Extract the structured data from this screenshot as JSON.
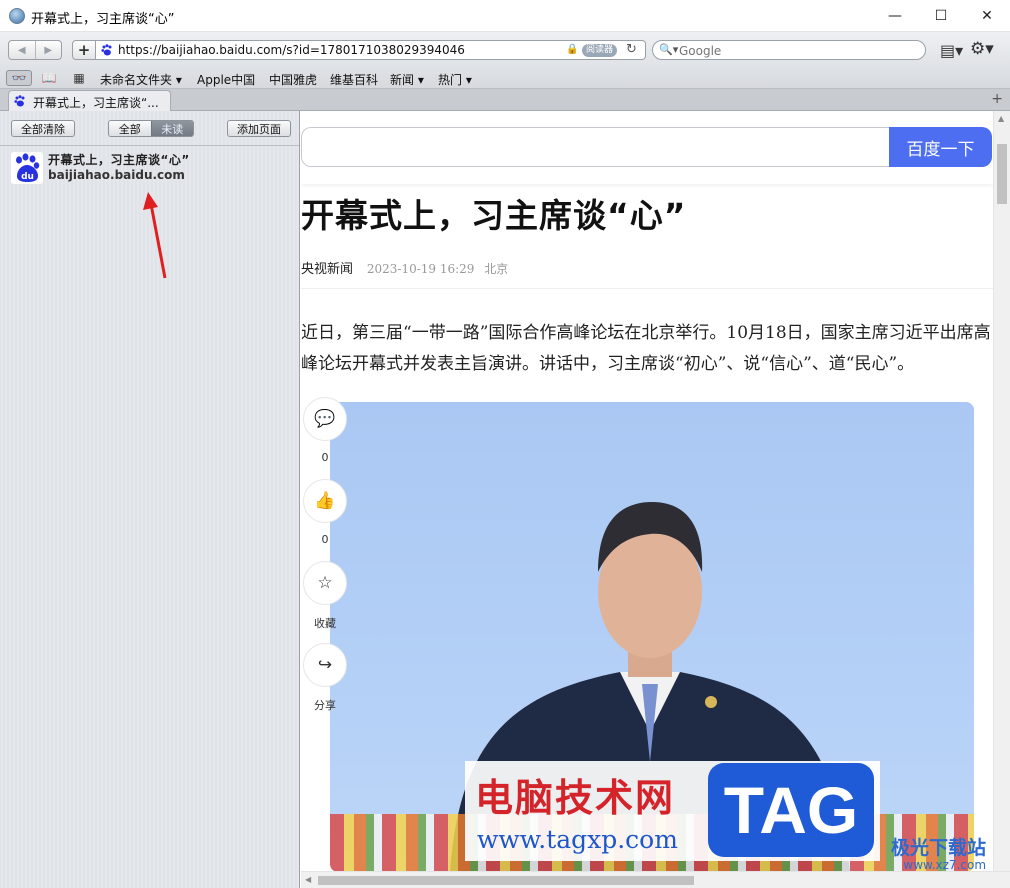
{
  "window": {
    "title": "开幕式上，习主席谈“心”",
    "minimize_glyph": "—",
    "maximize_glyph": "☐",
    "close_glyph": "✕"
  },
  "toolbar": {
    "back_glyph": "◀",
    "forward_glyph": "▶",
    "add_glyph": "+",
    "url": "https://baijiahao.baidu.com/s?id=1780171038029394046",
    "lock_glyph": "🔒",
    "reader_label": "阅读器",
    "reload_glyph": "↻",
    "search_icon_glyph": "🔍▾",
    "search_placeholder": "Google",
    "page_menu_glyph": "▤▾",
    "settings_glyph": "⚙▾"
  },
  "bookmarks": {
    "reading_glyph": "👓",
    "book_glyph": "📖",
    "grid_glyph": "▦",
    "items": [
      {
        "label": "未命名文件夹 ▾"
      },
      {
        "label": "Apple中国"
      },
      {
        "label": "中国雅虎"
      },
      {
        "label": "维基百科"
      },
      {
        "label": "新闻 ▾"
      },
      {
        "label": "热门 ▾"
      }
    ]
  },
  "tabs": [
    {
      "title": "开幕式上，习主席谈“..."
    }
  ],
  "tab_add_glyph": "+",
  "sidebar": {
    "clear_all": "全部清除",
    "seg_all": "全部",
    "seg_unread": "未读",
    "add_page": "添加页面",
    "items": [
      {
        "title": "开幕式上，习主席谈“心”",
        "domain": "baijiahao.baidu.com"
      }
    ]
  },
  "page": {
    "search_button": "百度一下",
    "title": "开幕式上，习主席谈“心”",
    "source": "央视新闻",
    "date": "2023-10-19 16:29",
    "location": "北京",
    "paragraph": "近日，第三届“一带一路”国际合作高峰论坛在北京举行。10月18日，国家主席习近平出席高峰论坛开幕式并发表主旨演讲。讲话中，习主席谈“初心”、说“信心”、道“民心”。",
    "actions": [
      {
        "glyph": "💬",
        "label": "0"
      },
      {
        "glyph": "👍",
        "label": "0"
      },
      {
        "glyph": "☆",
        "label": "收藏"
      },
      {
        "glyph": "↪",
        "label": "分享"
      }
    ],
    "watermark_cn": "电脑技术网",
    "watermark_url": "www.tagxp.com",
    "watermark_tag": "TAG",
    "corner_cn": "极光下载站",
    "corner_url": "www.xz7.com"
  }
}
